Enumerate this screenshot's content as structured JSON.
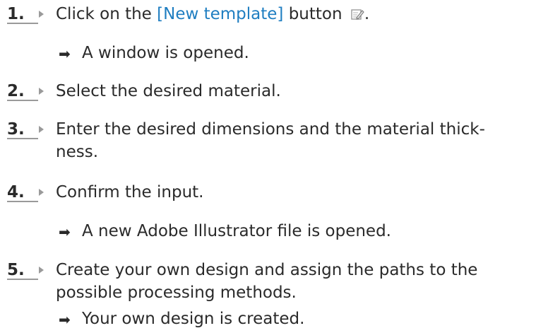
{
  "steps": [
    {
      "number": "1.",
      "text_before": "Click on the ",
      "link": "[New template]",
      "text_after": " button",
      "icon": "new-template-edit-icon",
      "trailing": "."
    },
    {
      "number": "2.",
      "text": "Select the desired material."
    },
    {
      "number": "3.",
      "line1": "Enter the desired dimensions and the material thick-",
      "line2": "ness."
    },
    {
      "number": "4.",
      "text": "Confirm the input."
    },
    {
      "number": "5.",
      "line1": "Create your own design and assign the paths to the",
      "line2": "possible processing methods."
    }
  ],
  "results": [
    {
      "arrow": "➡",
      "text": "A window is opened."
    },
    {
      "arrow": "➡",
      "text": "A new Adobe Illustrator file is opened."
    },
    {
      "arrow": "➡",
      "text": "Your own design is created."
    }
  ],
  "colors": {
    "text": "#2a2a2a",
    "link": "#1f7ec1",
    "marker": "#9a9a9a"
  }
}
